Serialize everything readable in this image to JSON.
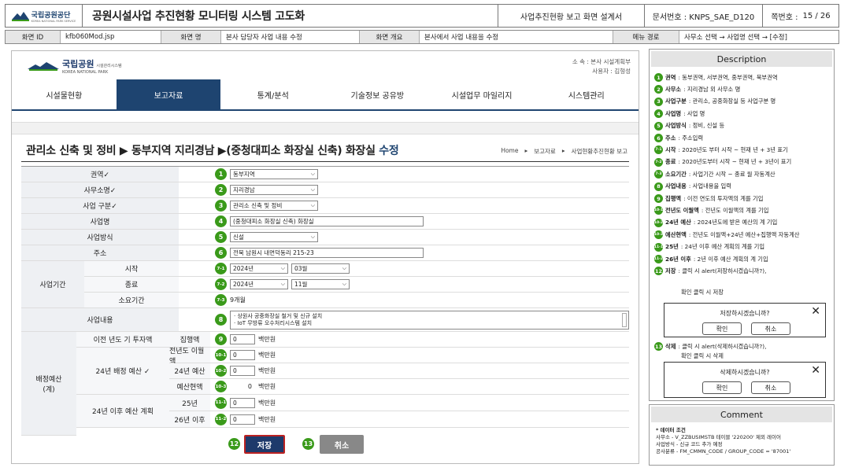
{
  "doc": {
    "org_name": "국립공원공단",
    "org_sub": "KOREA NATIONAL PARK SERVICE",
    "title": "공원시설사업 추진현황 모니터링 시스템 고도화",
    "subtitle": "사업추진현황 보고 화면 설계서",
    "doc_no": "문서번호 : KNPS_SAE_D120",
    "page_label": "쪽번호 :",
    "page_value": "15 / 26"
  },
  "meta": {
    "screen_id_label": "화면 ID",
    "screen_id": "kfb060Mod.jsp",
    "screen_name_label": "화면 명",
    "screen_name": "본사 담당자 사업 내용 수정",
    "overview_label": "화면 개요",
    "overview": "본사에서 사업 내용을 수정",
    "menu_label": "메뉴 경로",
    "menu_path": "사무소 선택 → 사업명 선택 → [수정]"
  },
  "app": {
    "brand": "국립공원",
    "brand_tag": "시설관리시스템",
    "brand_en": "KOREA NATIONAL PARK",
    "affiliation": "소  속 : 본사 시설계획부",
    "user": "사용자 : 김형성",
    "tabs": [
      "시설물현황",
      "보고자료",
      "통계/분석",
      "기술정보 공유방",
      "시설업무 마일리지",
      "시스템관리"
    ]
  },
  "page": {
    "title_main": "관리소 신축 및 정비 ▶ 동부지역 지리경남 ▶(중청대피소 화장실 신축) 화장실",
    "title_accent": "수정",
    "crumbs": [
      "Home",
      "▸",
      "보고자료",
      "▸",
      "사업현황추진현황 보고"
    ]
  },
  "form": {
    "region_label": "권역✓",
    "region_value": "동부지역",
    "office_label": "사무소명✓",
    "office_value": "지리경남",
    "category_label": "사업 구분✓",
    "category_value": "관리소 신축 및 정비",
    "project_label": "사업명",
    "project_value": "(중청대피소 화장실 신축) 화장실",
    "method_label": "사업방식",
    "method_value": "신설",
    "address_label": "주소",
    "address_value": "전북 남원시 내면덕동리 215-23",
    "period_label": "사업기간",
    "start_label": "시작",
    "start_year": "2024년",
    "start_month": "03월",
    "end_label": "종료",
    "end_year": "2024년",
    "end_month": "11월",
    "duration_label": "소요기간",
    "duration_value": "9개월",
    "content_label": "사업내용",
    "content_line1": "· 상원사 공중화장실 철거 및 신규 설치",
    "content_line2": "· IoT 무방류 오수처리시스템 설치",
    "budget_label": "배정예산\n(계)",
    "prev_invest_label": "이전 년도 기 투자액",
    "exec_label": "집행액",
    "exec_value": "0",
    "b24_label": "24년 배정 예산 ✓",
    "prev_unexec_label": "전년도 이월액",
    "prev_unexec_value": "0",
    "b24_budget_label": "24년 예산",
    "b24_budget_value": "0",
    "b24_exec_label": "예산현액",
    "b24_exec_value": "0",
    "after24_label": "24년 이후 예산 계획",
    "y25_label": "25년",
    "y25_value": "0",
    "y26_label": "26년 이후",
    "y26_value": "0",
    "unit": "백만원",
    "badges": [
      "1",
      "2",
      "3",
      "4",
      "5",
      "6",
      "7-1",
      "7-2",
      "7-3",
      "8",
      "9",
      "10-1",
      "10-2",
      "10-3",
      "11-1",
      "11-2",
      "12",
      "13"
    ]
  },
  "buttons": {
    "save": "저장",
    "cancel": "취소"
  },
  "description": {
    "title": "Description",
    "items": [
      {
        "n": "1",
        "k": "권역",
        "t": " : 동부권역, 서부권역, 중부권역, 북부권역"
      },
      {
        "n": "2",
        "k": "사무소",
        "t": " : 지리경남 외 사무소 명"
      },
      {
        "n": "3",
        "k": "사업구분",
        "t": " : 관리소, 공중화장실 등 사업구분 명"
      },
      {
        "n": "4",
        "k": "사업명",
        "t": " : 사업 명"
      },
      {
        "n": "5",
        "k": "사업방식",
        "t": " : 정비, 신설 등"
      },
      {
        "n": "6",
        "k": "주소",
        "t": " : 주소입력"
      },
      {
        "n": "7-1",
        "k": "시작",
        "t": " : 2020년도 부터 시작 ~ 현재 년 + 3년 표기"
      },
      {
        "n": "7-2",
        "k": "종료",
        "t": " : 2020년도부터 시작 ~ 현재 년 + 3년이 표기"
      },
      {
        "n": "7-3",
        "k": "소요기간",
        "t": " : 사업기간 시작 ~ 종료 월 자동계산"
      },
      {
        "n": "8",
        "k": "사업내용",
        "t": " : 사업내용을 입력"
      },
      {
        "n": "9",
        "k": "집행액",
        "t": " : 이전 연도의 투자액의 계를 기입"
      },
      {
        "n": "10-1",
        "k": "전년도 이월액",
        "t": " : 전년도 이월액의 계를 기입"
      },
      {
        "n": "10-2",
        "k": "24년 예산",
        "t": " : 2024년도에 받은 예산의 계 기입"
      },
      {
        "n": "10-3",
        "k": "예산현액",
        "t": " : 전년도 이월액+24년 예산+집행액 자동계산"
      },
      {
        "n": "11-1",
        "k": "25년",
        "t": " : 24년 이후 예산 계획의 계를 기입"
      },
      {
        "n": "11-2",
        "k": "26년 이후",
        "t": " : 2년 이후 예산 계획의 계 기입"
      },
      {
        "n": "12",
        "k": "저장",
        "t": " : 클릭 시 alert(저장하시겠습니까?),"
      }
    ],
    "save_note": "확인 클릭 시 저장",
    "save_dialog_msg": "저장하시겠습니까?",
    "delete_line_k": "삭제",
    "delete_line_t": " : 클릭 시 alert(삭제하시겠습니까?),",
    "delete_note": "확인 클릭 시 삭제",
    "delete_dialog_msg": "삭제하시겠습니까?",
    "ok": "확인",
    "cancel": "취소"
  },
  "comment": {
    "title": "Comment",
    "heading": "* 데이터 조건",
    "lines": [
      "사무소 - V_ZZBUSIMSTB 테이블 '220200' 제외 레이어",
      "사업방식 - 신규 코드 추가 예정",
      "공사분류 - FM_CMMN_CODE / GROUP_CODE = '87001'"
    ]
  },
  "colors": {
    "accent": "#1e4470",
    "badge": "#3a9a1a",
    "save_border": "#bb2222"
  }
}
